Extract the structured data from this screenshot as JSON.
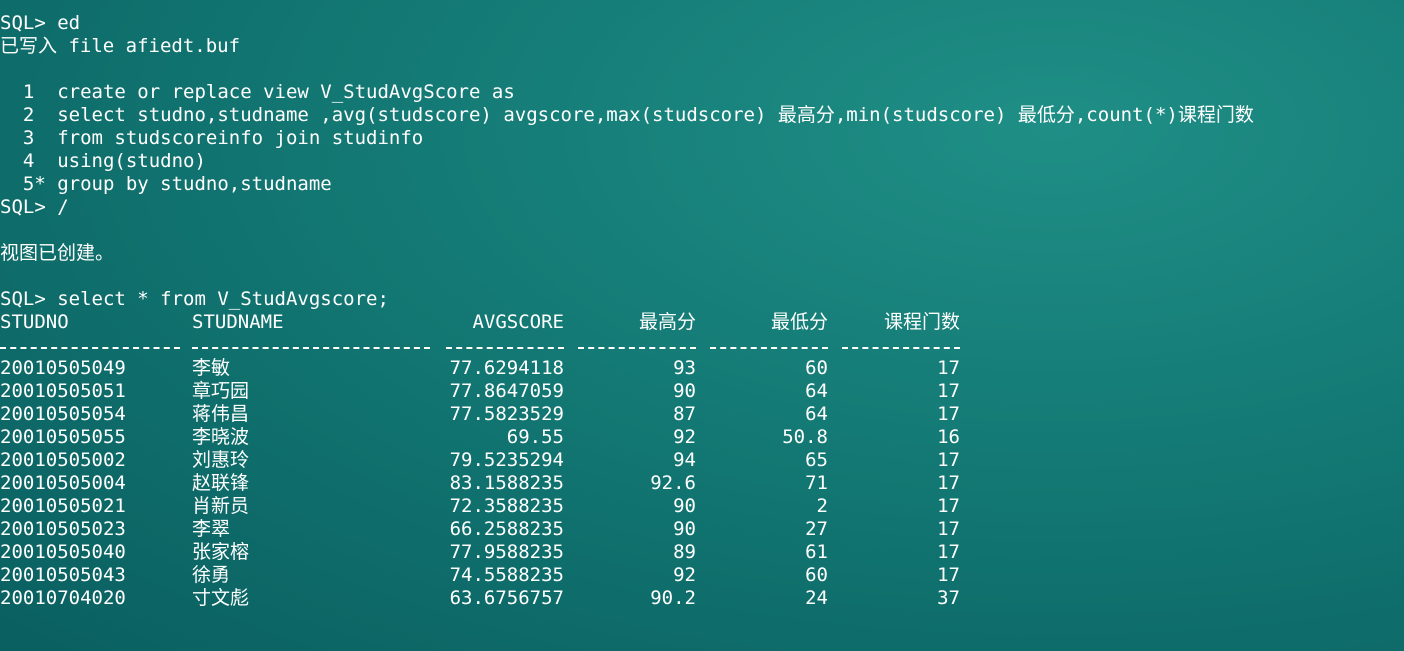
{
  "terminal": {
    "lines_top": [
      "SQL> ed",
      "已写入 file afiedt.buf",
      "",
      "  1  create or replace view V_StudAvgScore as",
      "  2  select studno,studname ,avg(studscore) avgscore,max(studscore) 最高分,min(studscore) 最低分,count(*)课程门数",
      "  3  from studscoreinfo join studinfo",
      "  4  using(studno)",
      "  5* group by studno,studname",
      "SQL> /",
      "",
      "视图已创建。",
      "",
      "SQL> select * from V_StudAvgscore;"
    ]
  },
  "result": {
    "columns": [
      "STUDNO",
      "STUDNAME",
      "AVGSCORE",
      "最高分",
      "最低分",
      "课程门数"
    ],
    "rows": [
      [
        "20010505049",
        "李敏",
        "77.6294118",
        "93",
        "60",
        "17"
      ],
      [
        "20010505051",
        "章巧园",
        "77.8647059",
        "90",
        "64",
        "17"
      ],
      [
        "20010505054",
        "蒋伟昌",
        "77.5823529",
        "87",
        "64",
        "17"
      ],
      [
        "20010505055",
        "李晓波",
        "69.55",
        "92",
        "50.8",
        "16"
      ],
      [
        "20010505002",
        "刘惠玲",
        "79.5235294",
        "94",
        "65",
        "17"
      ],
      [
        "20010505004",
        "赵联锋",
        "83.1588235",
        "92.6",
        "71",
        "17"
      ],
      [
        "20010505021",
        "肖新员",
        "72.3588235",
        "90",
        "2",
        "17"
      ],
      [
        "20010505023",
        "李翠",
        "66.2588235",
        "90",
        "27",
        "17"
      ],
      [
        "20010505040",
        "张家榕",
        "77.9588235",
        "89",
        "61",
        "17"
      ],
      [
        "20010505043",
        "徐勇",
        "74.5588235",
        "92",
        "60",
        "17"
      ],
      [
        "20010704020",
        "寸文彪",
        "63.6756757",
        "90.2",
        "24",
        "37"
      ]
    ]
  }
}
